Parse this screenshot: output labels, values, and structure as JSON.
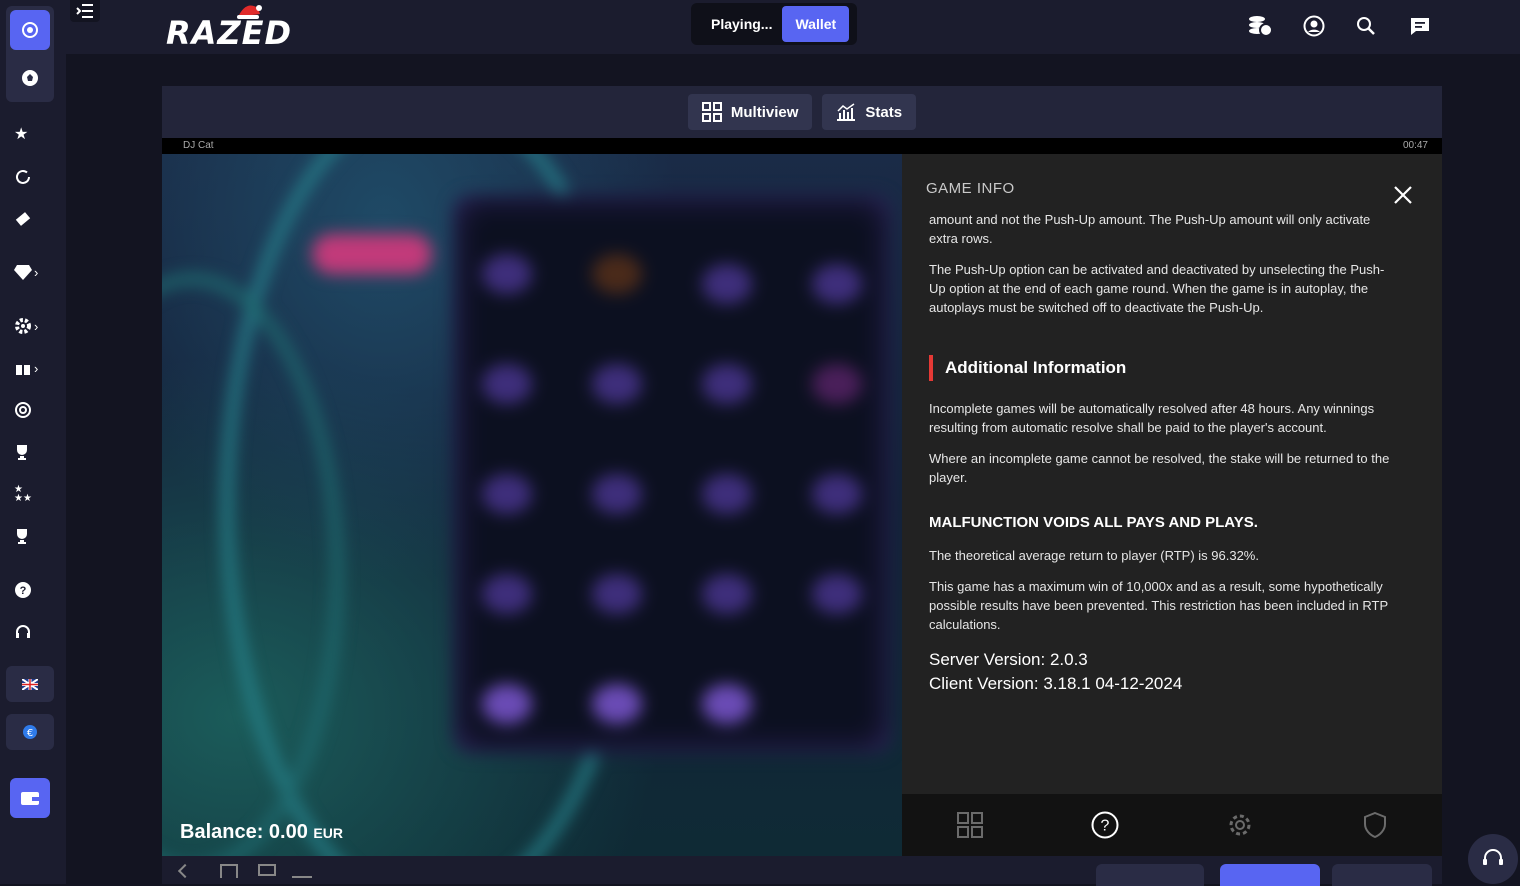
{
  "brand": {
    "logo_text": "RAZED"
  },
  "header": {
    "mode_playing_label": "Playing...",
    "wallet_label": "Wallet"
  },
  "game": {
    "tabs": [
      {
        "label": "Multiview",
        "icon": "grid-icon"
      },
      {
        "label": "Stats",
        "icon": "chart-icon"
      }
    ],
    "name": "DJ Cat",
    "timer": "00:47",
    "balance_label": "Balance: 0.00",
    "balance_currency": "EUR"
  },
  "info": {
    "title": "GAME INFO",
    "para1": "amount and not the Push-Up amount. The Push-Up amount will only activate extra rows.",
    "para2": "The Push-Up option can be activated and deactivated by unselecting the Push-Up option at the end of each game round. When the game is in autoplay, the autoplays must be switched off to deactivate the Push-Up.",
    "section_heading": "Additional Information",
    "para3": "Incomplete games will be automatically resolved after 48 hours. Any winnings resulting from automatic resolve shall be paid to the player's account.",
    "para4": "Where an incomplete game cannot be resolved, the stake will be returned to the player.",
    "malfunction": "MALFUNCTION VOIDS ALL PAYS AND PLAYS.",
    "rtp": "The theoretical average return to player (RTP) is 96.32%.",
    "max_win": "This game has a maximum win of 10,000x and as a result, some hypothetically possible results have been prevented. This restriction has been included in RTP calculations.",
    "server_version": "Server Version: 2.0.3",
    "client_version": "Client Version: 3.18.1 04-12-2024"
  },
  "colors": {
    "accent": "#5865f2",
    "sidebar_bg": "#1b1c2e",
    "section_marker": "#e53935"
  }
}
